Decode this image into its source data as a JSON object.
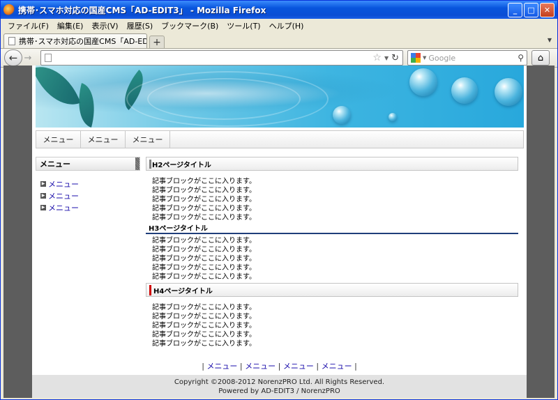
{
  "window": {
    "title": "携帯･スマホ対応の国産CMS「AD-EDIT3」 - Mozilla Firefox"
  },
  "menubar": [
    "ファイル(F)",
    "編集(E)",
    "表示(V)",
    "履歴(S)",
    "ブックマーク(B)",
    "ツール(T)",
    "ヘルプ(H)"
  ],
  "tab": {
    "label": "携帯･スマホ対応の国産CMS「AD-EDIT3」",
    "new_tab": "+"
  },
  "navbar": {
    "url": "",
    "search_placeholder": "Google"
  },
  "gnav": [
    "メニュー",
    "メニュー",
    "メニュー"
  ],
  "sidebar": {
    "heading": "メニュー",
    "items": [
      "メニュー",
      "メニュー",
      "メニュー"
    ]
  },
  "main": {
    "h2": "H2ページタイトル",
    "h3": "H3ページタイトル",
    "h4": "H4ページタイトル",
    "article_line": "記事ブロックがここに入ります。"
  },
  "footer_nav": {
    "links": [
      "メニュー",
      "メニュー",
      "メニュー",
      "メニュー"
    ],
    "separator": "|"
  },
  "footer": {
    "copyright": "Copyright ©2008-2012 NorenzPRO Ltd. All Rights Reserved.",
    "powered": "Powered by AD-EDIT3 / NorenzPRO"
  },
  "icons": {
    "back": "back-arrow-icon",
    "forward": "forward-arrow-icon",
    "bookmark": "star-icon",
    "reload": "reload-icon",
    "search": "magnifier-icon",
    "home": "home-icon"
  },
  "colors": {
    "titlebar": "#0855dd",
    "link": "#1a0dab",
    "h3_rule": "#1f3e7a",
    "h4_marker": "#d00000"
  }
}
